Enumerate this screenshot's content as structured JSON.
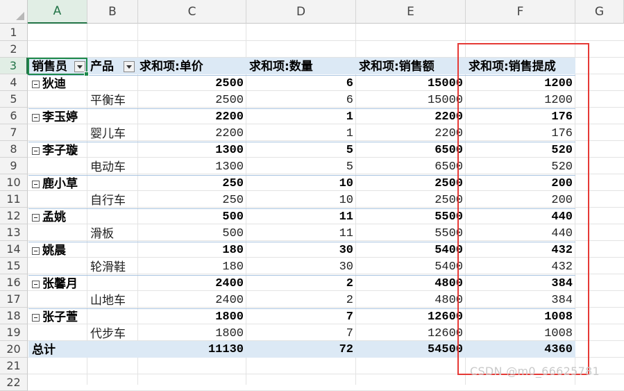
{
  "column_headers": [
    "A",
    "B",
    "C",
    "D",
    "E",
    "F",
    "G"
  ],
  "row_numbers": [
    "1",
    "2",
    "3",
    "4",
    "5",
    "6",
    "7",
    "8",
    "9",
    "10",
    "11",
    "12",
    "13",
    "14",
    "15",
    "16",
    "17",
    "18",
    "19",
    "20",
    "21",
    "22"
  ],
  "pivot": {
    "header": {
      "salesperson": "销售员",
      "product": "产品",
      "sum_price": "求和项:单价",
      "sum_qty": "求和项:数量",
      "sum_sales": "求和项:销售额",
      "sum_commission": "求和项:销售提成"
    },
    "rows": [
      {
        "kind": "group",
        "label": "狄迪",
        "price": "2500",
        "qty": "6",
        "sales": "15000",
        "commission": "1200"
      },
      {
        "kind": "item",
        "label": "平衡车",
        "price": "2500",
        "qty": "6",
        "sales": "15000",
        "commission": "1200"
      },
      {
        "kind": "group",
        "label": "李玉婷",
        "price": "2200",
        "qty": "1",
        "sales": "2200",
        "commission": "176"
      },
      {
        "kind": "item",
        "label": "婴儿车",
        "price": "2200",
        "qty": "1",
        "sales": "2200",
        "commission": "176"
      },
      {
        "kind": "group",
        "label": "李子璇",
        "price": "1300",
        "qty": "5",
        "sales": "6500",
        "commission": "520"
      },
      {
        "kind": "item",
        "label": "电动车",
        "price": "1300",
        "qty": "5",
        "sales": "6500",
        "commission": "520"
      },
      {
        "kind": "group",
        "label": "鹿小草",
        "price": "250",
        "qty": "10",
        "sales": "2500",
        "commission": "200"
      },
      {
        "kind": "item",
        "label": "自行车",
        "price": "250",
        "qty": "10",
        "sales": "2500",
        "commission": "200"
      },
      {
        "kind": "group",
        "label": "孟姚",
        "price": "500",
        "qty": "11",
        "sales": "5500",
        "commission": "440"
      },
      {
        "kind": "item",
        "label": "滑板",
        "price": "500",
        "qty": "11",
        "sales": "5500",
        "commission": "440"
      },
      {
        "kind": "group",
        "label": "姚晨",
        "price": "180",
        "qty": "30",
        "sales": "5400",
        "commission": "432"
      },
      {
        "kind": "item",
        "label": "轮滑鞋",
        "price": "180",
        "qty": "30",
        "sales": "5400",
        "commission": "432"
      },
      {
        "kind": "group",
        "label": "张馨月",
        "price": "2400",
        "qty": "2",
        "sales": "4800",
        "commission": "384"
      },
      {
        "kind": "item",
        "label": "山地车",
        "price": "2400",
        "qty": "2",
        "sales": "4800",
        "commission": "384"
      },
      {
        "kind": "group",
        "label": "张子萱",
        "price": "1800",
        "qty": "7",
        "sales": "12600",
        "commission": "1008"
      },
      {
        "kind": "item",
        "label": "代步车",
        "price": "1800",
        "qty": "7",
        "sales": "12600",
        "commission": "1008"
      }
    ],
    "total": {
      "label": "总计",
      "price": "11130",
      "qty": "72",
      "sales": "54500",
      "commission": "4360"
    }
  },
  "watermark": "CSDN @m0_66625781",
  "colors": {
    "selection": "#1e8a4c",
    "highlight_box": "#e53935",
    "pivot_band": "#dce9f5"
  }
}
